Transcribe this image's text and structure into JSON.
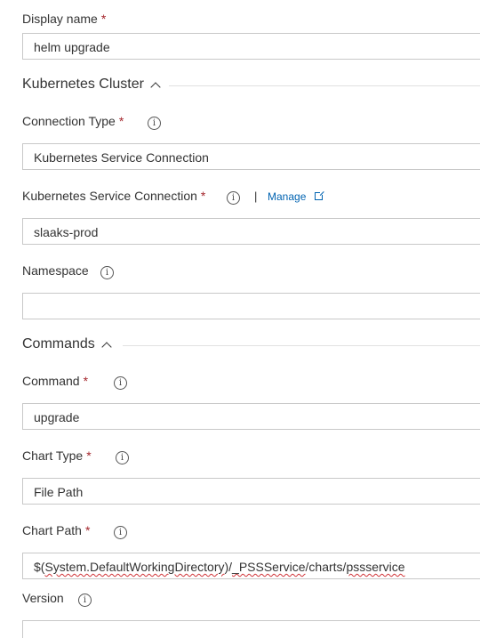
{
  "display_name": {
    "label": "Display name",
    "required_mark": "*",
    "value": "helm upgrade"
  },
  "kubernetes_cluster_section": {
    "title": "Kubernetes Cluster"
  },
  "connection_type": {
    "label": "Connection Type",
    "required_mark": "*",
    "value": "Kubernetes Service Connection"
  },
  "service_connection": {
    "label": "Kubernetes Service Connection",
    "required_mark": "*",
    "separator": "|",
    "manage_label": "Manage",
    "value": "slaaks-prod"
  },
  "namespace": {
    "label": "Namespace",
    "value": ""
  },
  "commands_section": {
    "title": "Commands"
  },
  "command": {
    "label": "Command",
    "required_mark": "*",
    "value": "upgrade"
  },
  "chart_type": {
    "label": "Chart Type",
    "required_mark": "*",
    "value": "File Path"
  },
  "chart_path": {
    "label": "Chart Path",
    "required_mark": "*",
    "value_parts": [
      "$(",
      "System.DefaultWorkingDirectory",
      ")/",
      "_PSSService",
      "/charts/",
      "pssservice"
    ]
  },
  "version": {
    "label": "Version",
    "value": ""
  },
  "info_icon_glyph": "i",
  "colors": {
    "required": "#a4262c",
    "link": "#0063b1",
    "border": "#c8c8c8",
    "spellcheck": "#d13438"
  }
}
